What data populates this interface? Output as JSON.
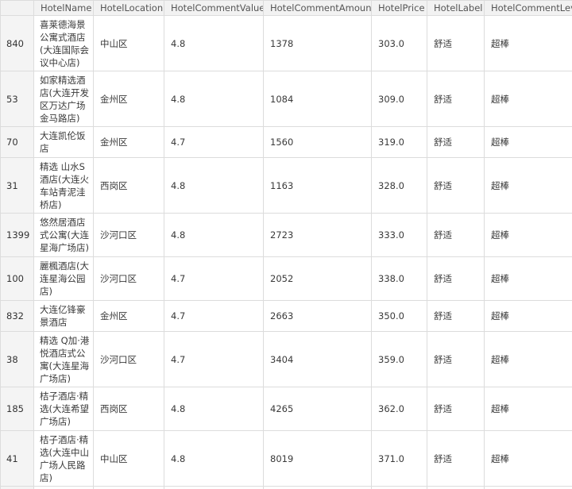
{
  "columns": [
    "HotelName",
    "HotelLocation",
    "HotelCommentValue",
    "HotelCommentAmount",
    "HotelPrice",
    "HotelLabel",
    "HotelCommentLevel"
  ],
  "rows": [
    {
      "index": "840",
      "name": "喜莱德海景公寓式酒店(大连国际会议中心店)",
      "location": "中山区",
      "comment_value": "4.8",
      "comment_amount": "1378",
      "price": "303.0",
      "label": "舒适",
      "comment_level": "超棒"
    },
    {
      "index": "53",
      "name": "如家精选酒店(大连开发区万达广场金马路店)",
      "location": "金州区",
      "comment_value": "4.8",
      "comment_amount": "1084",
      "price": "309.0",
      "label": "舒适",
      "comment_level": "超棒"
    },
    {
      "index": "70",
      "name": "大连凯伦饭店",
      "location": "金州区",
      "comment_value": "4.7",
      "comment_amount": "1560",
      "price": "319.0",
      "label": "舒适",
      "comment_level": "超棒"
    },
    {
      "index": "31",
      "name": "精选 山水S酒店(大连火车站青泥洼桥店)",
      "location": "西岗区",
      "comment_value": "4.8",
      "comment_amount": "1163",
      "price": "328.0",
      "label": "舒适",
      "comment_level": "超棒"
    },
    {
      "index": "1399",
      "name": "悠然居酒店式公寓(大连星海广场店)",
      "location": "沙河口区",
      "comment_value": "4.8",
      "comment_amount": "2723",
      "price": "333.0",
      "label": "舒适",
      "comment_level": "超棒"
    },
    {
      "index": "100",
      "name": "麗楓酒店(大连星海公园店)",
      "location": "沙河口区",
      "comment_value": "4.7",
      "comment_amount": "2052",
      "price": "338.0",
      "label": "舒适",
      "comment_level": "超棒"
    },
    {
      "index": "832",
      "name": "大连亿锋豪景酒店",
      "location": "金州区",
      "comment_value": "4.7",
      "comment_amount": "2663",
      "price": "350.0",
      "label": "舒适",
      "comment_level": "超棒"
    },
    {
      "index": "38",
      "name": "精选 Q加·港悦酒店式公寓(大连星海广场店)",
      "location": "沙河口区",
      "comment_value": "4.7",
      "comment_amount": "3404",
      "price": "359.0",
      "label": "舒适",
      "comment_level": "超棒"
    },
    {
      "index": "185",
      "name": "桔子酒店·精选(大连希望广场店)",
      "location": "西岗区",
      "comment_value": "4.8",
      "comment_amount": "4265",
      "price": "362.0",
      "label": "舒适",
      "comment_level": "超棒"
    },
    {
      "index": "41",
      "name": "桔子酒店·精选(大连中山广场人民路店)",
      "location": "中山区",
      "comment_value": "4.8",
      "comment_amount": "8019",
      "price": "371.0",
      "label": "舒适",
      "comment_level": "超棒"
    }
  ]
}
